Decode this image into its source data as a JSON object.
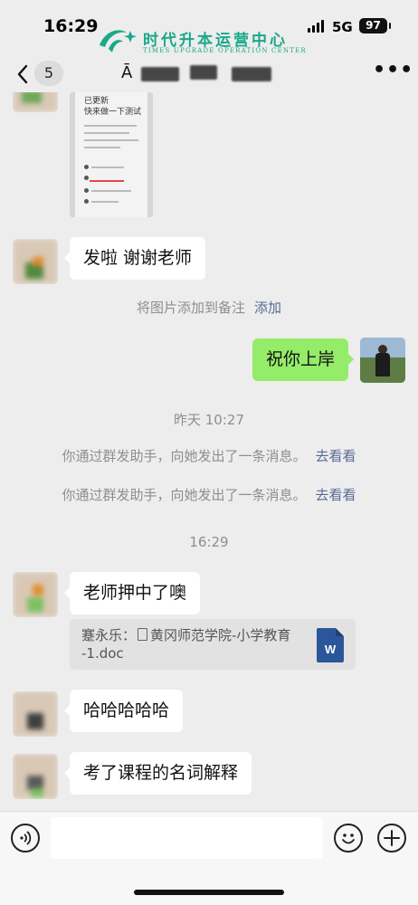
{
  "status_bar": {
    "time": "16:29",
    "network": "5G",
    "battery": "97"
  },
  "watermark": {
    "title": "时代升本运营中心",
    "subtitle": "TIMES UPGRADE OPERATION CENTER"
  },
  "nav": {
    "back_count": "5",
    "title_prefix": "Ā"
  },
  "messages": [
    {
      "kind": "image",
      "side": "left",
      "lines": [
        "已更新",
        "快来做一下测试"
      ]
    },
    {
      "kind": "text",
      "side": "left",
      "text": "发啦 谢谢老师"
    },
    {
      "kind": "system",
      "text": "将图片添加到备注",
      "link": "添加"
    },
    {
      "kind": "text",
      "side": "right",
      "text": "祝你上岸"
    },
    {
      "kind": "timestamp",
      "text": "昨天 10:27"
    },
    {
      "kind": "system",
      "text": "你通过群发助手，向她发出了一条消息。",
      "link": "去看看"
    },
    {
      "kind": "system",
      "text": "你通过群发助手，向她发出了一条消息。",
      "link": "去看看"
    },
    {
      "kind": "timestamp",
      "text": "16:29"
    },
    {
      "kind": "text",
      "side": "left",
      "text": "老师押中了噢"
    },
    {
      "kind": "file",
      "side": "left",
      "sender": "蹇永乐：",
      "filename_line1": "黄冈师范学院-小学教育",
      "filename_line2": "-1.doc",
      "file_icon": "W"
    },
    {
      "kind": "text",
      "side": "left",
      "text": "哈哈哈哈哈"
    },
    {
      "kind": "text",
      "side": "left",
      "text": "考了课程的名词解释"
    }
  ],
  "input": {
    "placeholder": "",
    "value": ""
  },
  "icons": {
    "back": "chevron-left-icon",
    "more": "more-dots-icon",
    "voice": "voice-icon",
    "emoji": "emoji-icon",
    "plus": "plus-icon",
    "file": "word-doc-icon"
  },
  "colors": {
    "background": "#ededed",
    "bubble_self": "#95ec69",
    "bubble_other": "#ffffff",
    "link": "#576b95",
    "system_text": "#8e8e8e",
    "watermark": "#1aa88a",
    "word_blue": "#2b579a"
  }
}
